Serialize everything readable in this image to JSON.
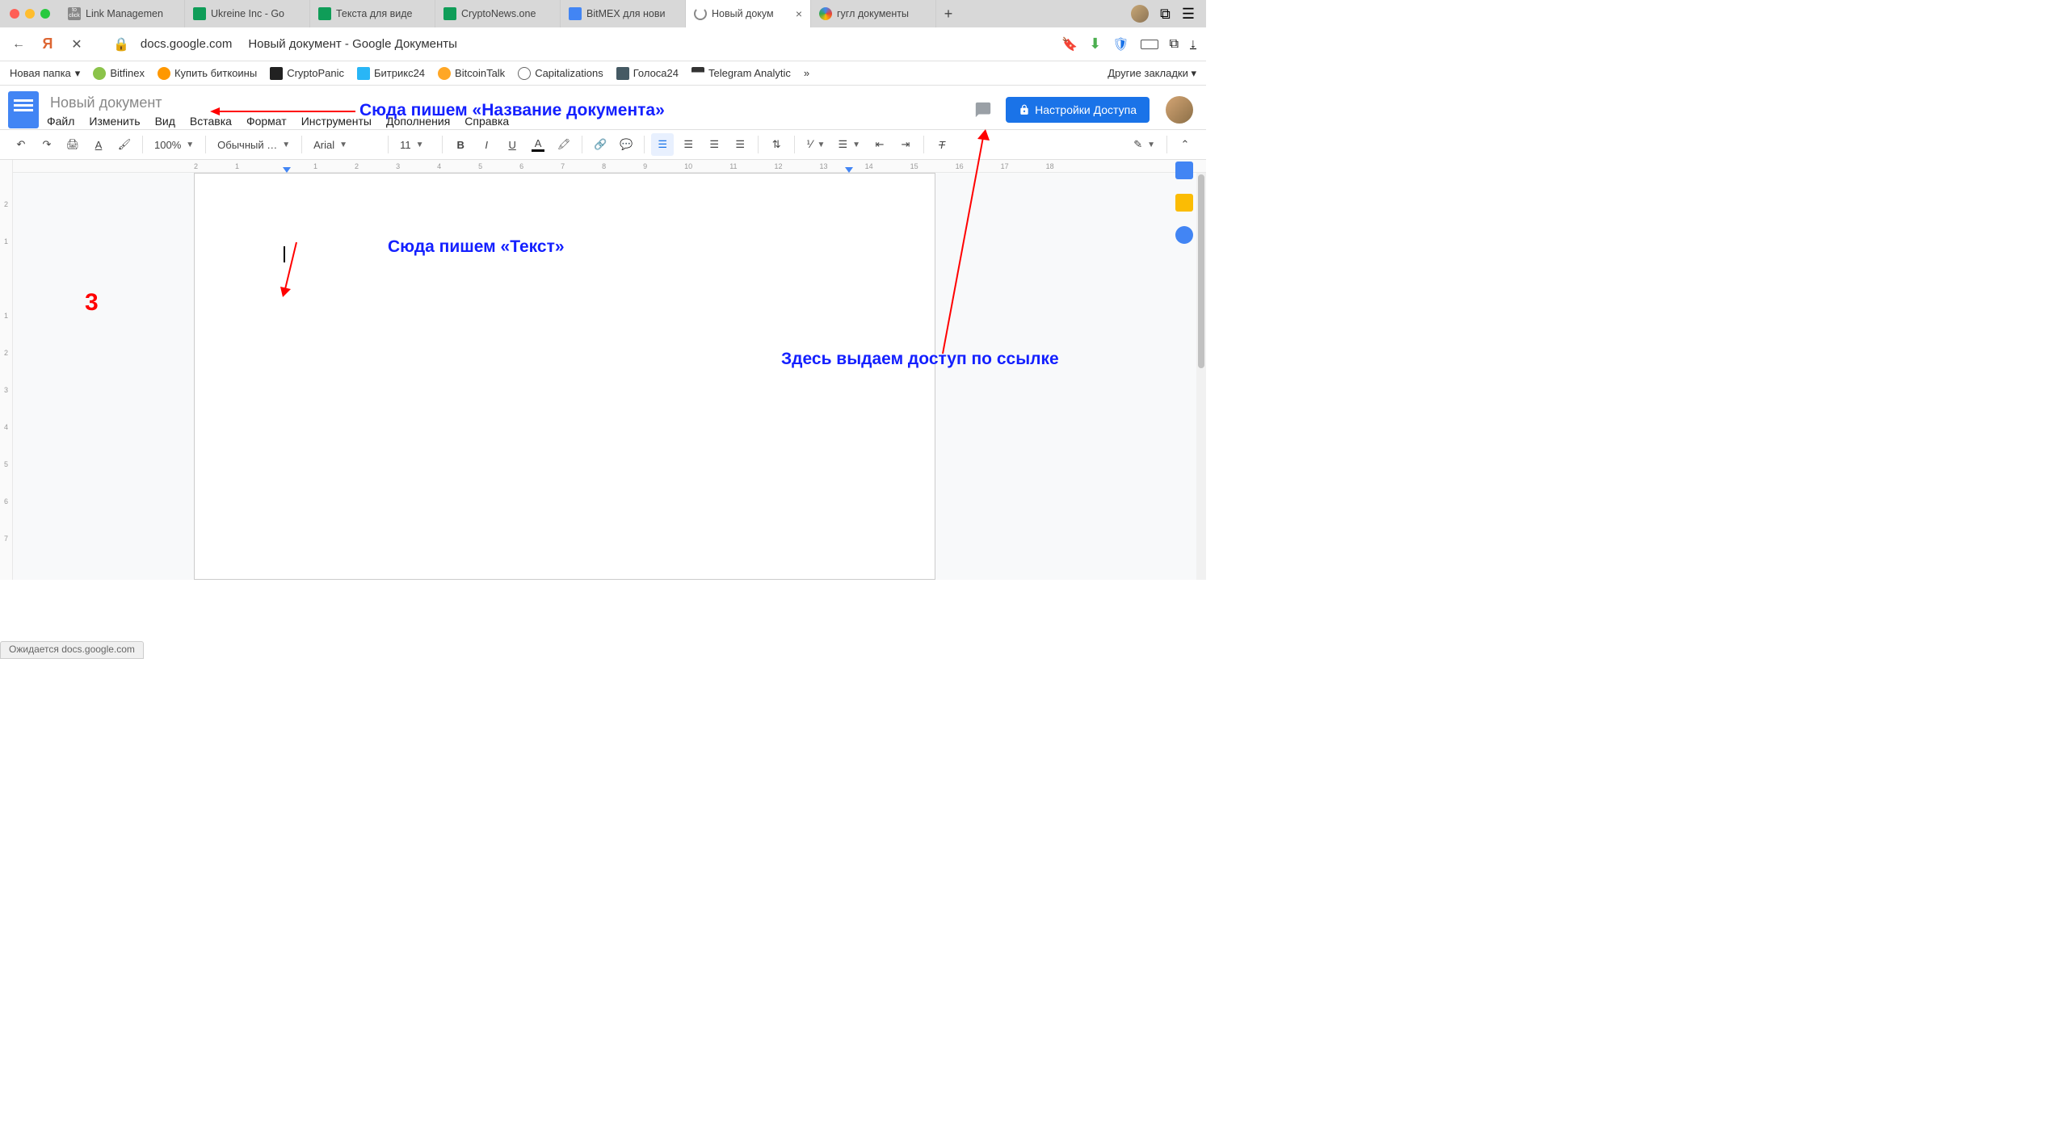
{
  "browser_tabs": [
    {
      "title": "Link Managemen"
    },
    {
      "title": "Ukreine Inc - Go"
    },
    {
      "title": "Текста для виде"
    },
    {
      "title": "CryptoNews.one"
    },
    {
      "title": "BitMEX для нови"
    },
    {
      "title": "Новый докум"
    },
    {
      "title": "гугл документы"
    }
  ],
  "url_bar": {
    "host": "docs.google.com",
    "page_title": "Новый документ - Google Документы"
  },
  "bookmarks": [
    {
      "label": "Новая папка",
      "arrow": "▾"
    },
    {
      "label": "Bitfinex"
    },
    {
      "label": "Купить биткоины"
    },
    {
      "label": "CryptoPanic"
    },
    {
      "label": "Битрикс24"
    },
    {
      "label": "BitcoinTalk"
    },
    {
      "label": "Capitalizations"
    },
    {
      "label": "Голоса24"
    },
    {
      "label": "Telegram Analytic"
    }
  ],
  "bookmarks_more": "»",
  "bookmarks_right": "Другие закладки ▾",
  "doc": {
    "title": "Новый документ",
    "menus": [
      "Файл",
      "Изменить",
      "Вид",
      "Вставка",
      "Формат",
      "Инструменты",
      "Дополнения",
      "Справка"
    ],
    "share_button": "Настройки Доступа"
  },
  "toolbar": {
    "zoom": "100%",
    "style": "Обычный …",
    "font": "Arial",
    "font_size": "11"
  },
  "ruler_h": [
    "2",
    "1",
    "",
    "1",
    "2",
    "3",
    "4",
    "5",
    "6",
    "7",
    "8",
    "9",
    "10",
    "11",
    "12",
    "13",
    "14",
    "15",
    "16",
    "17",
    "18"
  ],
  "ruler_v": [
    "",
    "2",
    "1",
    "",
    "1",
    "2",
    "3",
    "4",
    "5",
    "6",
    "7"
  ],
  "annotations": {
    "title": "Сюда пишем «Название документа»",
    "text": "Сюда пишем «Текст»",
    "access": "Здесь выдаем доступ по ссылке",
    "step": "3"
  },
  "status": "Ожидается docs.google.com"
}
